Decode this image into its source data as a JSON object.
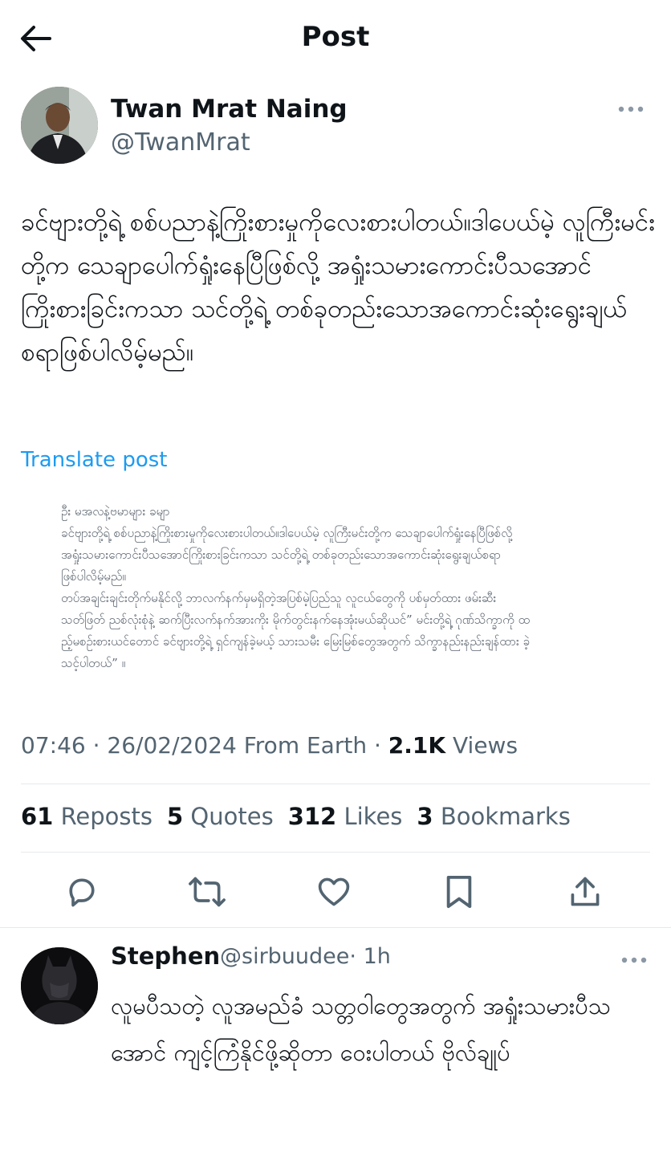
{
  "header": {
    "title": "Post",
    "back_icon": "arrow-left-icon"
  },
  "post": {
    "author": {
      "name": "Twan Mrat Naing",
      "handle": "@TwanMrat",
      "more_icon": "more-horizontal-icon"
    },
    "text": "ခင်ဗျားတို့ရဲ့ စစ်ပညာနဲ့ကြိုးစားမှုကိုလေးစားပါတယ်။ဒါပေယ်မဲ့ လူကြီးမင်းတို့က သေချာပေါက်ရှုံးနေပြီဖြစ်လို့ အရှုံးသမားကောင်းပီသအောင်ကြိုးစားခြင်းကသာ သင်တို့ရဲ့ တစ်ခုတည်းသောအကောင်းဆုံးရွေးချယ်စရာဖြစ်ပါလိမ့်မည်။",
    "translate_label": "Translate post",
    "quoted_image_lines": [
      "ဦး မအလနဲ့ဗမာများ ခမျာ",
      "ခင်ဗျားတို့ရဲ့ စစ်ပညာနဲ့ကြိုးစားမှုကိုလေးစားပါတယ်။ဒါပေယ်မဲ့ လူကြီးမင်းတို့က သေချာပေါက်ရှုံးနေပြီဖြစ်လို့",
      "အရှုံးသမားကောင်းပီသအောင်ကြိုးစားခြင်းကသာ သင်တို့ရဲ့ တစ်ခုတည်းသောအကောင်းဆုံးရွေးချယ်စရာ",
      "ဖြစ်ပါလိမ့်မည်။",
      "တပ်အချင်းချင်းတိုက်မနိုင်လို့ ဘာလက်နက်မှမရှိတဲ့အပြစ်မဲ့ပြည်သူ လူငယ်တွေကို ပစ်မှတ်ထား ဖမ်းဆီး",
      "သတ်ဖြတ် ညစ်လုံးစုံနဲ့ ဆက်ပြီးလက်နက်အားကိုး မိုက်တွင်းနက်နေအုံးမယ်ဆိုယင်” မင်းတို့ရဲ့ ဂုဏ်သိက္ခာကို ထ",
      "ည့်မစဉ်းစားယင်တောင် ခင်ဗျားတို့ရဲ့ ရှင်ကျန်ခဲ့မယ့် သားသမီး မြေးမြစ်တွေအတွက် သိက္ခာနည်းနည်းချန်ထား ခဲ့",
      "သင့်ပါတယ်” ။"
    ],
    "meta": {
      "time": "07:46",
      "date": "26/02/2024",
      "location": "From Earth",
      "views_count": "2.1K",
      "views_label": "Views",
      "sep": "·"
    },
    "stats": {
      "reposts_count": "61",
      "reposts_label": "Reposts",
      "quotes_count": "5",
      "quotes_label": "Quotes",
      "likes_count": "312",
      "likes_label": "Likes",
      "bookmarks_count": "3",
      "bookmarks_label": "Bookmarks"
    },
    "actions": [
      "reply-icon",
      "repost-icon",
      "like-icon",
      "bookmark-icon",
      "share-icon"
    ]
  },
  "reply": {
    "name": "Stephen",
    "handle": "@sirbuudee",
    "time": "· 1h",
    "text": "လူမပီသတဲ့ လူအမည်ခံ သတ္တဝါတွေအတွက် အရှုံးသမားပီသအောင် ကျင့်ကြံနိုင်ဖို့ဆိုတာ ဝေးပါတယ် ဗိုလ်ချုပ်"
  },
  "colors": {
    "text": "#0f1419",
    "secondary": "#536471",
    "accent": "#1d9bf0",
    "divider": "#e6e9eb"
  }
}
